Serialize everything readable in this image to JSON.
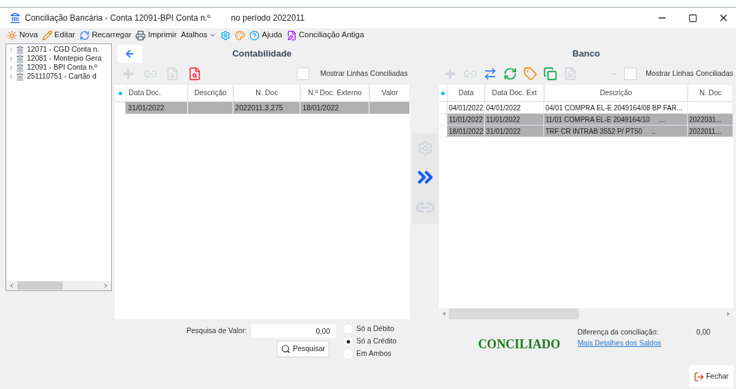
{
  "window": {
    "title": "Conciliação Bancária - Conta 12091-BPI Conta n.º",
    "period": "no período 2022011"
  },
  "toolbar": [
    {
      "kind": "nova",
      "label": "Nova"
    },
    {
      "kind": "editar",
      "label": "Editar"
    },
    {
      "kind": "recarregar",
      "label": "Recarregar"
    },
    {
      "kind": "imprimir",
      "label": "Imprimir"
    },
    {
      "kind": "menu",
      "label": "Atalhos"
    },
    {
      "kind": "gear"
    },
    {
      "kind": "palette"
    },
    {
      "kind": "ajuda",
      "label": "Ajuda"
    },
    {
      "kind": "antiga",
      "label": "Conciliação Antiga"
    }
  ],
  "tree": {
    "items": [
      {
        "label": "12071 - CGD Conta n.",
        "expanded": false
      },
      {
        "label": "12081 - Montepio Gera",
        "expanded": false
      },
      {
        "label": "12091 - BPI Conta n.º",
        "expanded": false
      },
      {
        "label": "251110751 - Cartão d",
        "expanded": false
      }
    ]
  },
  "contabilidade": {
    "title": "Contabilidade",
    "show_reconciled": {
      "label": "Mostrar Linhas Conciliadas",
      "checked": false
    },
    "columns": [
      "Data Doc.",
      "Descrição",
      "N. Doc",
      "N.º Doc. Externo",
      "Valor"
    ],
    "rows": [
      {
        "cells": [
          "31/01/2022",
          "",
          "2022011.3.275",
          "18/01/2022",
          ""
        ],
        "selected": true
      }
    ]
  },
  "banco": {
    "title": "Banco",
    "show_reconciled": {
      "label": "Mostrar Linhas Conciliadas",
      "checked": false
    },
    "columns": [
      "Data",
      "Data Doc. Ext",
      "Descrição",
      "N. Doc"
    ],
    "rows": [
      {
        "cells": [
          "04/01/2022",
          "04/01/2022",
          "04/01 COMPRA EL-E 2049164/08 BP FAR...",
          ""
        ],
        "selected": false
      },
      {
        "cells": [
          "11/01/2022",
          "11/01/2022",
          "11/01 COMPRA EL-E 2049164/10     ...",
          "2022031..."
        ],
        "selected": true
      },
      {
        "cells": [
          "18/01/2022",
          "31/01/2022",
          "TRF CR INTRAB 3552 P/ PT50     ..",
          "2022011..."
        ],
        "selected": true
      }
    ]
  },
  "search": {
    "label": "Pesquisa de Valor:",
    "value": "0,00",
    "button": "Pesquisar",
    "options": [
      {
        "label": "Só a Débito",
        "selected": false
      },
      {
        "label": "Só a Crédito",
        "selected": true
      },
      {
        "label": "Em Ambos",
        "selected": false
      }
    ]
  },
  "status": {
    "text": "CONCILIADO",
    "difference_label": "Diferença da conciliação:",
    "difference_value": "0,00",
    "details_link": "Mais Detalhes dos Saldos"
  },
  "close_button": "Fechar"
}
